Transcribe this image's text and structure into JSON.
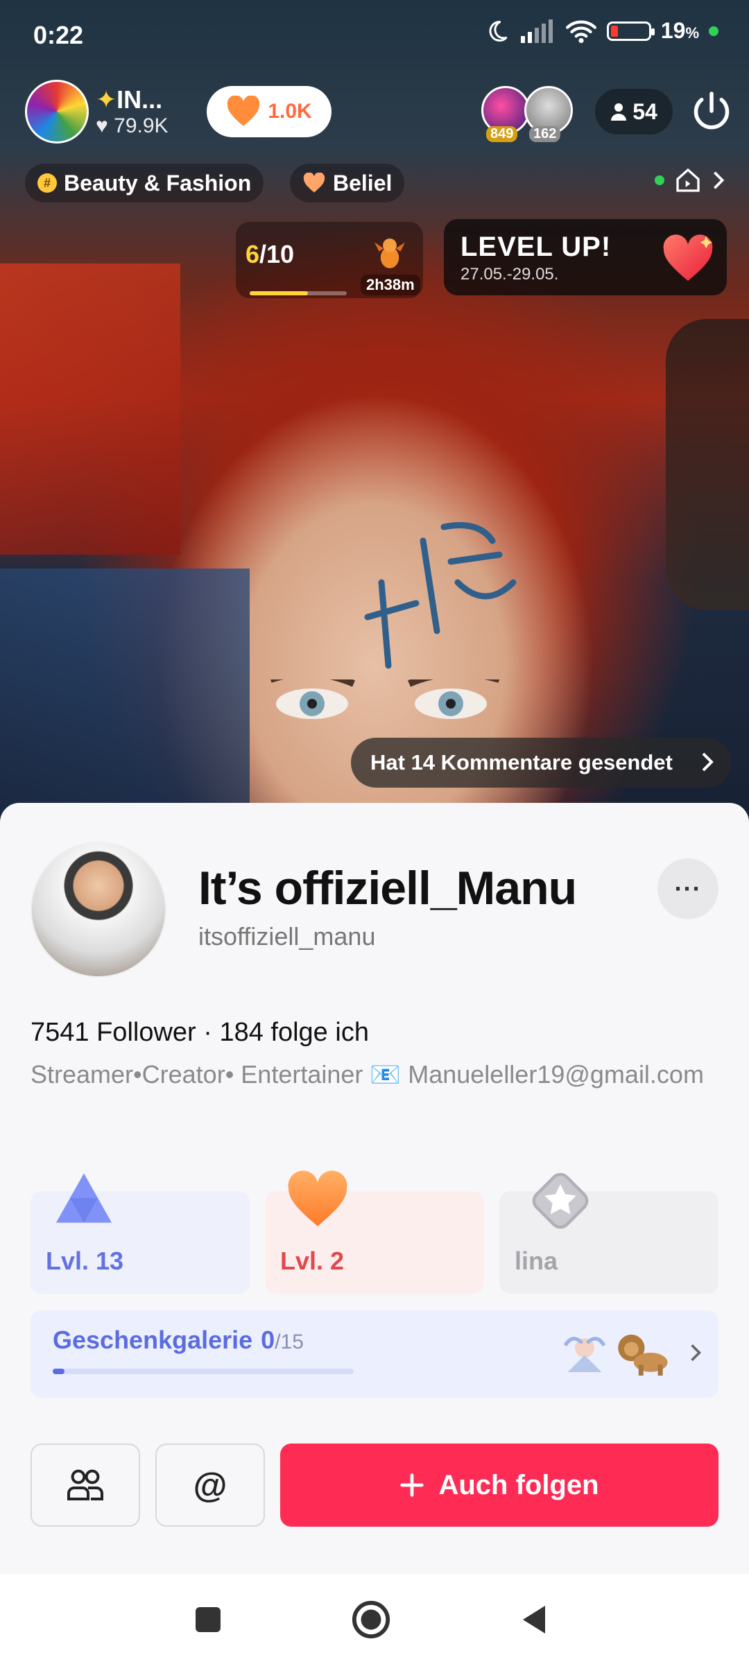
{
  "status_bar": {
    "time": "0:22",
    "battery": "19",
    "battery_unit": "%"
  },
  "live": {
    "host_name": "IN...",
    "host_likes": "79.9K",
    "like_button_value": "1.0K",
    "viewer_badges": [
      "849",
      "162"
    ],
    "viewer_count": "54",
    "tags": [
      "Beauty & Fashion",
      "Beliel"
    ],
    "progress": {
      "current": "6",
      "total": "/10",
      "fraction": 0.6
    },
    "timer": "2h38m",
    "level_up": {
      "title": "LEVEL UP!",
      "dates": "27.05.-29.05."
    },
    "comment_notice": "Hat 14 Kommentare gesendet"
  },
  "profile": {
    "display_name": "It’s offiziell_Manu",
    "handle": "itsoffiziell_manu",
    "more_label": "···",
    "stats": "7541 Follower · 184 folge ich",
    "bio": "Streamer•Creator• Entertainer 📧 Manueleller19@gmail.com",
    "badges": [
      {
        "label": "Lvl. 13",
        "icon": "triangle-icon",
        "color": "#6272e2"
      },
      {
        "label": "Lvl. 2",
        "icon": "heart-icon",
        "color": "#e3484c"
      },
      {
        "label": "lina",
        "icon": "star-badge-icon",
        "color": "#a4a4aa"
      }
    ],
    "gallery": {
      "title": "Geschenkgalerie",
      "count": "0",
      "total": "/15",
      "fraction": 0.04
    },
    "follow_button": "Auch folgen",
    "mention_label": "@"
  },
  "colors": {
    "accent": "#fe2c55",
    "gallery_blue": "#5a6ce0"
  }
}
